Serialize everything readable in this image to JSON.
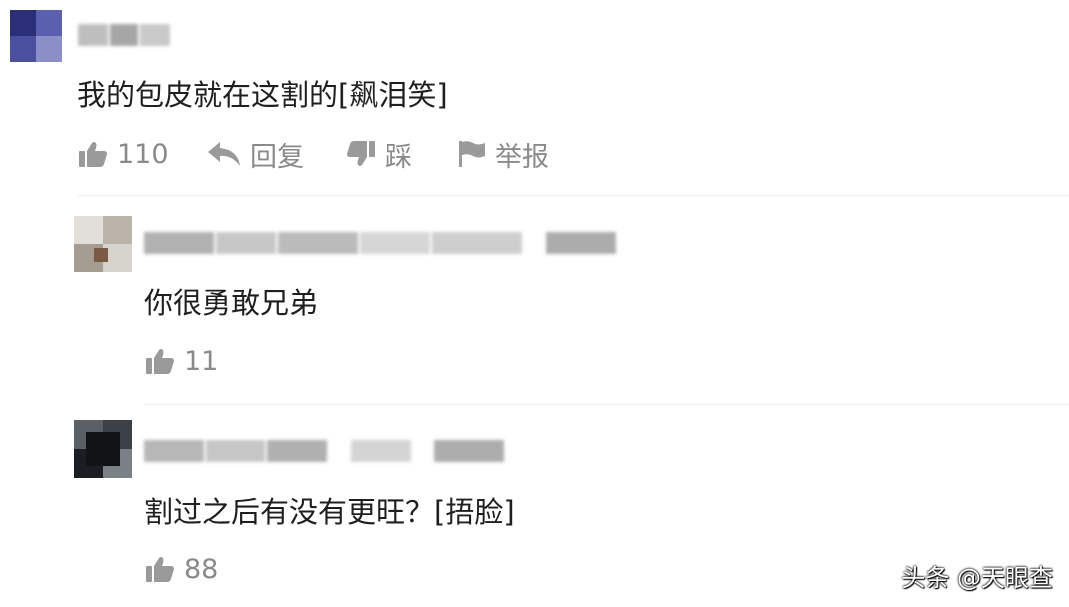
{
  "comments": [
    {
      "text": "我的包皮就在这割的[飙泪笑]",
      "like_count": "110",
      "reply_label": "回复",
      "dislike_label": "踩",
      "report_label": "举报"
    },
    {
      "text": "你很勇敢兄弟",
      "like_count": "11"
    },
    {
      "text": "割过之后有没有更旺？[捂脸]",
      "like_count": "88"
    }
  ],
  "watermark": "头条 @天眼查",
  "colors": {
    "icon_gray": "#9a9a9a",
    "text_main": "#1f1f1f",
    "text_muted": "#8a8a8a",
    "divider": "#eeeeee"
  },
  "icons": [
    "thumbs-up-icon",
    "reply-arrow-icon",
    "thumbs-down-icon",
    "flag-icon"
  ]
}
